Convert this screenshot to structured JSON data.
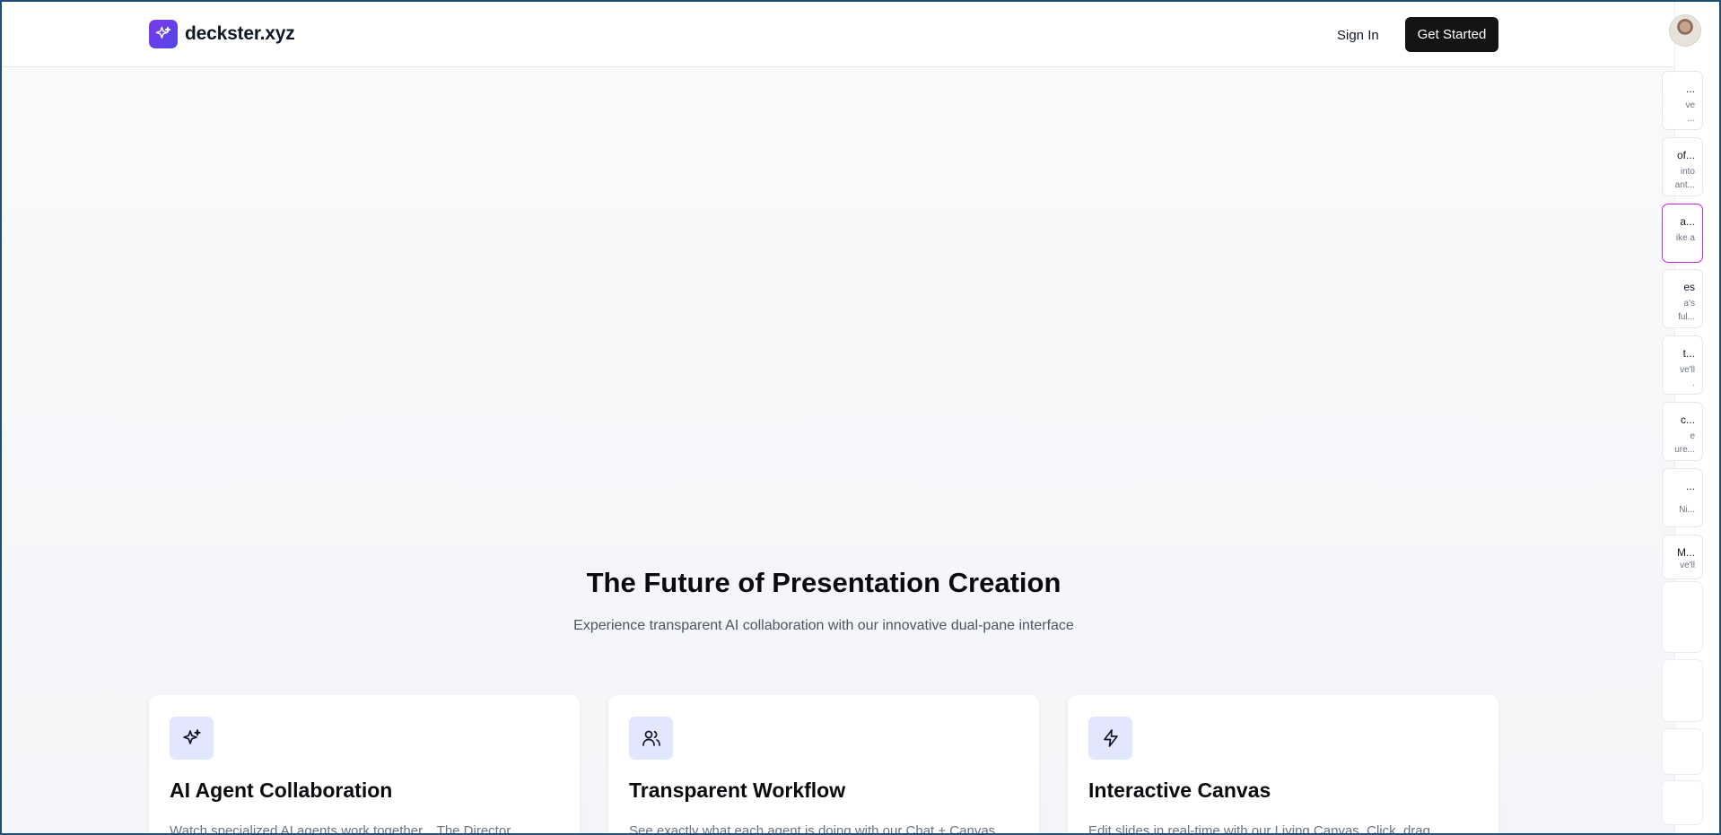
{
  "header": {
    "brand": "deckster.xyz",
    "sign_in": "Sign In",
    "get_started": "Get Started"
  },
  "hero": {
    "title": "The Future of Presentation Creation",
    "subtitle": "Experience transparent AI collaboration with our innovative dual-pane interface"
  },
  "features": [
    {
      "icon": "sparkles-icon",
      "title": "AI Agent Collaboration",
      "description": "Watch specialized AI agents work together... The Director..."
    },
    {
      "icon": "users-icon",
      "title": "Transparent Workflow",
      "description": "See exactly what each agent is doing with our Chat + Canvas..."
    },
    {
      "icon": "lightning-icon",
      "title": "Interactive Canvas",
      "description": "Edit slides in real-time with our Living Canvas. Click, drag..."
    }
  ],
  "side_panel": {
    "items": [
      {
        "title": "...",
        "desc": [
          "ve",
          "..."
        ]
      },
      {
        "title": "of...",
        "desc": [
          "into",
          "ant..."
        ]
      },
      {
        "title": "a...",
        "desc": [
          "ike a"
        ]
      },
      {
        "title": "es",
        "desc": [
          "a's",
          "ful..."
        ]
      },
      {
        "title": "t...",
        "desc": [
          "ve'll",
          "."
        ]
      },
      {
        "title": "c...",
        "desc": [
          "e",
          "ure..."
        ]
      },
      {
        "title": "...",
        "desc": [
          "Ni..."
        ]
      },
      {
        "title": "M...",
        "desc": [
          "ve'll"
        ]
      }
    ]
  },
  "colors": {
    "brand_gradient_start": "#7c3aed",
    "brand_gradient_end": "#4f46e5",
    "primary_button": "#141414",
    "icon_tile": "#e0e7ff",
    "active_item_border": "#c026d3"
  }
}
